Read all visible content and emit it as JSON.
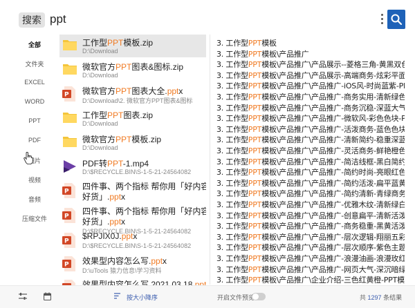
{
  "search": {
    "chip": "搜索",
    "query": "ppt"
  },
  "categories": [
    "全部",
    "文件夹",
    "EXCEL",
    "WORD",
    "PPT",
    "PDF",
    "图片",
    "视频",
    "音频",
    "压缩文件"
  ],
  "files": [
    {
      "icon": "folder-zip-icon",
      "name_pre": "工作型",
      "name_hl": "PPT",
      "name_post": "模板.zip",
      "path": "D:\\Download",
      "selected": true
    },
    {
      "icon": "folder-zip-icon",
      "name_pre": "微软官方",
      "name_hl": "PPT",
      "name_post": "图表&图标.zip",
      "path": "D:\\Download"
    },
    {
      "icon": "powerpoint-icon",
      "name_pre": "微软官方",
      "name_hl": "PPT",
      "name_post": "图表大全.",
      "name_hl2": "ppt",
      "name_post2": "x",
      "path": "D:\\Download\\2. 微软官方PPT图表&图标"
    },
    {
      "icon": "folder-zip-icon",
      "name_pre": "工作型",
      "name_hl": "PPT",
      "name_post": "图表.zip",
      "path": "D:\\Download"
    },
    {
      "icon": "folder-zip-icon",
      "name_pre": "微软官方",
      "name_hl": "PPT",
      "name_post": "模板.zip",
      "path": "D:\\Download"
    },
    {
      "icon": "video-icon",
      "name_pre": "PDF转",
      "name_hl": "PPT",
      "name_post": "-1.mp4",
      "path": "D:\\$RECYCLE.BIN\\S-1-5-21-24564082"
    },
    {
      "icon": "powerpoint-icon",
      "two_line": true,
      "line1": "四件事、两个指标 帮你用「好内容带",
      "line2_pre": "好货」.",
      "line2_hl": "ppt",
      "line2_post": "x"
    },
    {
      "icon": "powerpoint-icon",
      "two_line": true,
      "line1": "四件事、两个指标 帮你用「好内容带",
      "line2_pre": "好货」.",
      "line2_hl": "ppt",
      "line2_post": "x",
      "path": "D:\\$RECYCLE.BIN\\S-1-5-21-24564082"
    },
    {
      "icon": "powerpoint-icon",
      "name_pre": "$RPJIX0J.",
      "name_hl": "ppt",
      "name_post": "x",
      "path": "D:\\$RECYCLE.BIN\\S-1-5-21-24564082"
    },
    {
      "icon": "powerpoint-icon",
      "name_pre": "效果型内容怎么写.",
      "name_hl": "ppt",
      "name_post": "x",
      "path": "D:\\uTools 猿力信息\\学习资料"
    },
    {
      "icon": "powerpoint-icon",
      "name_pre": "效果型内容怎么写 2021.03.18.",
      "name_hl": "ppt",
      "name_post": "x",
      "path": ""
    }
  ],
  "preview_lines": [
    [
      "3. 工作型",
      "PPT",
      "模板"
    ],
    [
      "3. 工作型",
      "PPT",
      "模板\\产品推广"
    ],
    [
      "3. 工作型",
      "PPT",
      "模板\\产品推广\\产品展示--菱格三角-黄黑双色-P"
    ],
    [
      "3. 工作型",
      "PPT",
      "模板\\产品推广\\产品展示-高端商务-炫彩平面-PP"
    ],
    [
      "3. 工作型",
      "PPT",
      "模板\\产品推广\\产品推广-iOS风-时尚蓝紫-PPT模"
    ],
    [
      "3. 工作型",
      "PPT",
      "模板\\产品推广\\产品推广-商务实用-清新绿色-PP"
    ],
    [
      "3. 工作型",
      "PPT",
      "模板\\产品推广\\产品推广-商务沉稳-深蓝大气-PP"
    ],
    [
      "3. 工作型",
      "PPT",
      "模板\\产品推广\\产品推广-微软风-彩色色块-PPT模"
    ],
    [
      "3. 工作型",
      "PPT",
      "模板\\产品推广\\产品推广-活泼商务-蓝色色块-PP"
    ],
    [
      "3. 工作型",
      "PPT",
      "模板\\产品推广\\产品推广-清新简约-稳重深蓝-PP"
    ],
    [
      "3. 工作型",
      "PPT",
      "模板\\产品推广\\产品推广-灵活商务-鲜艳橙色-PP"
    ],
    [
      "3. 工作型",
      "PPT",
      "模板\\产品推广\\产品推广-简洁线框-黑白简约-PP"
    ],
    [
      "3. 工作型",
      "PPT",
      "模板\\产品推广\\产品推广-简约时尚-亮眼红色-PP"
    ],
    [
      "3. 工作型",
      "PPT",
      "模板\\产品推广\\产品推广-简约活泼-扁平蓝黄-PP"
    ],
    [
      "3. 工作型",
      "PPT",
      "模板\\产品推广\\产品推广-简约清新-青绿商务-PP"
    ],
    [
      "3. 工作型",
      "PPT",
      "模板\\产品推广\\产品推广-优雅木纹-清新绿白-PP"
    ],
    [
      "3. 工作型",
      "PPT",
      "模板\\产品推广\\产品推广-创意扁平-清新活泼-PP"
    ],
    [
      "3. 工作型",
      "PPT",
      "模板\\产品推广\\产品推广-商务稳重-黑黄活泼-PP"
    ],
    [
      "3. 工作型",
      "PPT",
      "模板\\产品推广\\产品推广-层次逻辑-翔丽五彩.pp"
    ],
    [
      "3. 工作型",
      "PPT",
      "模板\\产品推广\\产品推广-层次顺序-紫色主题.pp"
    ],
    [
      "3. 工作型",
      "PPT",
      "模板\\产品推广\\产品推广-浪漫油画-浪漫玫红-PP"
    ],
    [
      "3. 工作型",
      "PPT",
      "模板\\产品推广\\产品推广-网页大气-深沉暗绿-PP"
    ],
    [
      "3. 工作型",
      "PPT",
      "模板\\产品推广\\企业介绍-三色红黄橙-PPT模板.p"
    ]
  ],
  "footer": {
    "sort_label": "按大小降序",
    "preview_label": "开启文件预览",
    "count_pre": "共",
    "count": "1297",
    "count_post": "条结果"
  },
  "colors": {
    "highlight": "#f07a22",
    "accent": "#1e62b8"
  }
}
